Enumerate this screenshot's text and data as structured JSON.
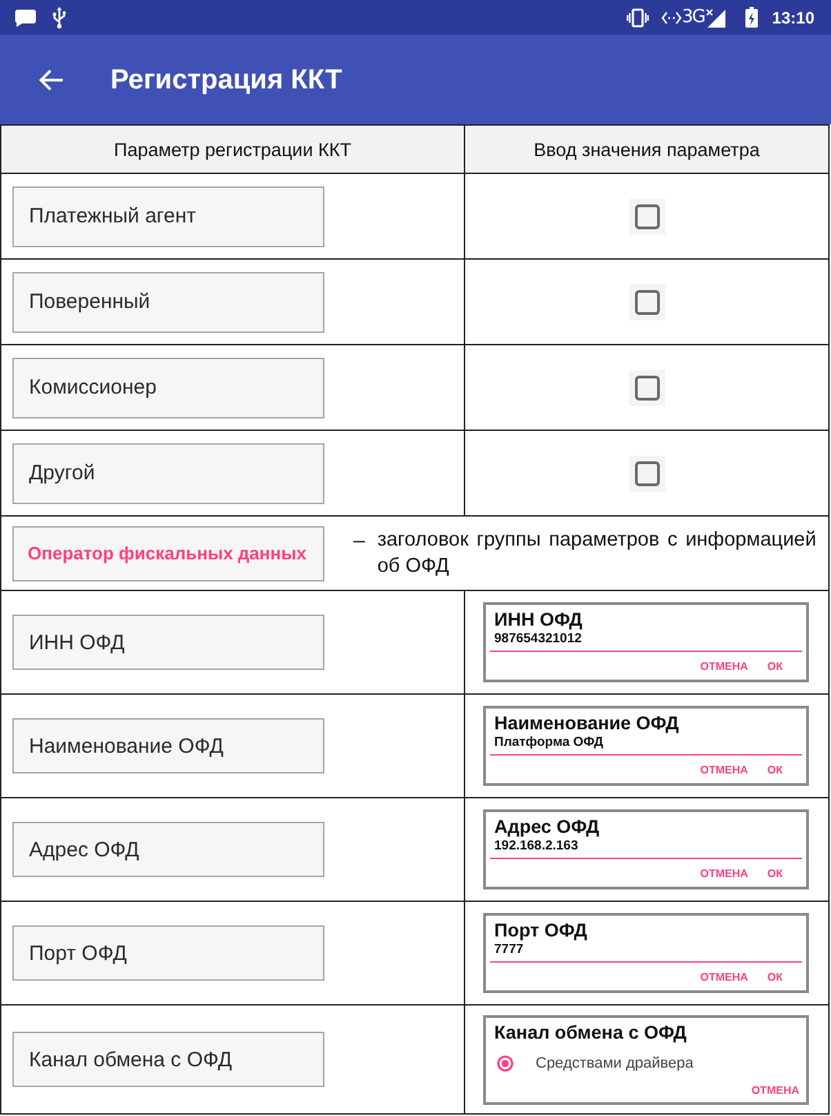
{
  "status_bar": {
    "network": "3G",
    "time": "13:10"
  },
  "app_bar": {
    "title": "Регистрация ККТ"
  },
  "table": {
    "columns": [
      "Параметр регистрации ККТ",
      "Ввод значения параметра"
    ],
    "rows": [
      {
        "kind": "checkbox",
        "label": "Платежный агент",
        "checked": false
      },
      {
        "kind": "checkbox",
        "label": "Поверенный",
        "checked": false
      },
      {
        "kind": "checkbox",
        "label": "Комиссионер",
        "checked": false
      },
      {
        "kind": "checkbox",
        "label": "Другой",
        "checked": false
      },
      {
        "kind": "group",
        "label": "Оператор фискальных данных",
        "marker": "–",
        "description": "заголовок группы параметров с информацией об ОФД"
      },
      {
        "kind": "text",
        "label": "ИНН ОФД",
        "dialog": {
          "title": "ИНН ОФД",
          "value": "987654321012",
          "buttons": [
            "ОТМЕНА",
            "ОК"
          ]
        }
      },
      {
        "kind": "text",
        "label": "Наименование ОФД",
        "dialog": {
          "title": "Наименование ОФД",
          "value": "Платформа ОФД",
          "buttons": [
            "ОТМЕНА",
            "ОК"
          ]
        }
      },
      {
        "kind": "text",
        "label": "Адрес ОФД",
        "dialog": {
          "title": "Адрес ОФД",
          "value": "192.168.2.163",
          "buttons": [
            "ОТМЕНА",
            "ОК"
          ]
        }
      },
      {
        "kind": "text",
        "label": "Порт ОФД",
        "dialog": {
          "title": "Порт ОФД",
          "value": "7777",
          "buttons": [
            "ОТМЕНА",
            "ОК"
          ]
        }
      },
      {
        "kind": "choice",
        "label": "Канал обмена с ОФД",
        "dialog": {
          "title": "Канал обмена с ОФД",
          "options": [
            {
              "label": "Средствами драйвера",
              "selected": true
            }
          ],
          "buttons": [
            "ОТМЕНА"
          ]
        }
      }
    ]
  }
}
